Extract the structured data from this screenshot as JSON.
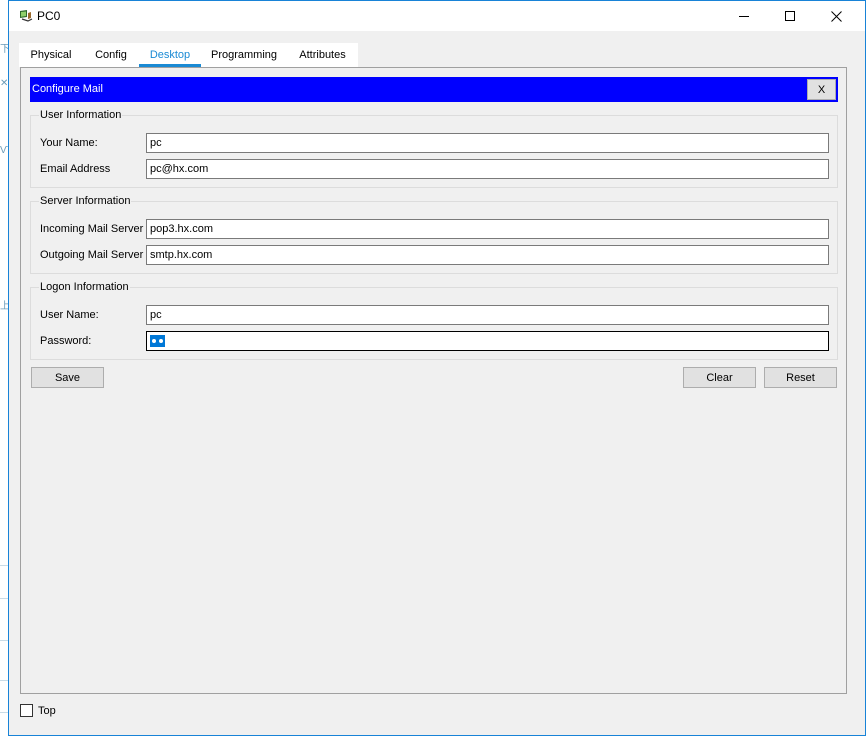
{
  "window": {
    "title": "PC0",
    "icon": "pc-device-icon",
    "controls": {
      "minimize": "minimize-icon",
      "maximize": "maximize-icon",
      "close": "close-icon"
    }
  },
  "tabs": [
    {
      "label": "Physical",
      "active": false
    },
    {
      "label": "Config",
      "active": false
    },
    {
      "label": "Desktop",
      "active": true
    },
    {
      "label": "Programming",
      "active": false
    },
    {
      "label": "Attributes",
      "active": false
    }
  ],
  "dialog": {
    "title": "Configure Mail",
    "close_label": "X",
    "header_color": "#0000ff"
  },
  "user_info": {
    "legend": "User Information",
    "your_name_label": "Your Name:",
    "your_name_value": "pc",
    "email_label": "Email Address",
    "email_value": "pc@hx.com"
  },
  "server_info": {
    "legend": "Server Information",
    "incoming_label": "Incoming Mail Server",
    "incoming_value": "pop3.hx.com",
    "outgoing_label": "Outgoing Mail Server",
    "outgoing_value": "smtp.hx.com"
  },
  "logon_info": {
    "legend": "Logon Information",
    "username_label": "User Name:",
    "username_value": "pc",
    "password_label": "Password:",
    "password_mask_count": 2
  },
  "buttons": {
    "save": "Save",
    "clear": "Clear",
    "reset": "Reset"
  },
  "footer": {
    "top_label": "Top",
    "top_checked": false
  },
  "colors": {
    "accent": "#1a8ad4",
    "selection": "#0078d7"
  }
}
